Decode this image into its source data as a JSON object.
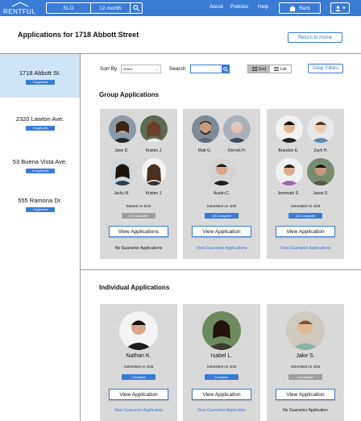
{
  "brand": "RENTFUL",
  "nav": {
    "location": "SLO",
    "term": "12-month",
    "links": [
      "About",
      "Policies",
      "Help"
    ],
    "rent_label": "Rent"
  },
  "page_title": "Applications for 1718 Abbott Street",
  "back_label": "Return to Home",
  "sidebar": [
    {
      "address": "1718 Abbott St.",
      "badge": "8 Applicants",
      "active": true
    },
    {
      "address": "2320 Lawton Ave.",
      "badge": "5 Applicants",
      "active": false
    },
    {
      "address": "53 Buena Vista Ave.",
      "badge": "10 Applicants",
      "active": false
    },
    {
      "address": "555 Ramona Dr.",
      "badge": "3 Applicants",
      "active": false
    }
  ],
  "controls": {
    "sort_label": "Sort By",
    "sort_value": "Select",
    "search_label": "Search",
    "grid_label": "Grid",
    "list_label": "List",
    "clear_label": "Clear Filters"
  },
  "group_section_title": "Group Applications",
  "individual_section_title": "Individual Applications",
  "group_apps": [
    {
      "members": [
        "Jane D.",
        "Kristen J.",
        "Jacky M.",
        "Kristen J."
      ],
      "submitted": "Started on 5/16",
      "status": "2/4 Complete",
      "status_complete": false,
      "button": "View Applications",
      "guarantor": "No Guarantor Applications",
      "guarantor_link": false
    },
    {
      "members": [
        "Matt G.",
        "Derrick H.",
        "Austin C."
      ],
      "submitted": "Submitted on 4/25",
      "status": "3/3 Complete",
      "status_complete": true,
      "button": "View Application",
      "guarantor": "View Guarantor Applications",
      "guarantor_link": true
    },
    {
      "members": [
        "Brandon E.",
        "Zach H.",
        "Jeremiah S.",
        "Jason D."
      ],
      "submitted": "Submitted on 4/26",
      "status": "4/4 Complete",
      "status_complete": true,
      "button": "View Application",
      "guarantor": "View Guarantor Applications",
      "guarantor_link": true
    }
  ],
  "individual_apps": [
    {
      "name": "Nathan K.",
      "submitted": "Submitted on 4/25",
      "status": "Complete",
      "status_complete": true,
      "button": "View Application",
      "guarantor": "View Guarantor Application",
      "guarantor_link": true
    },
    {
      "name": "Isabel L.",
      "submitted": "Submitted on 4/25",
      "status": "Complete",
      "status_complete": true,
      "button": "View Application",
      "guarantor": "View Guarantor Application",
      "guarantor_link": true
    },
    {
      "name": "Jake S.",
      "submitted": "Submitted on 4/25",
      "status": "Incomplete",
      "status_complete": false,
      "button": "View Application",
      "guarantor": "No Guarantor Application",
      "guarantor_link": false
    }
  ],
  "colors": {
    "accent": "#3a7bd5",
    "complete": "#3a7bd5",
    "incomplete": "#9e9e9e",
    "card": "#d9d9d9",
    "active_side": "#cfe4f5"
  },
  "icons": {
    "search": "search-icon",
    "rent": "home-icon",
    "user": "user-icon",
    "grid": "grid-icon",
    "list": "list-icon"
  }
}
